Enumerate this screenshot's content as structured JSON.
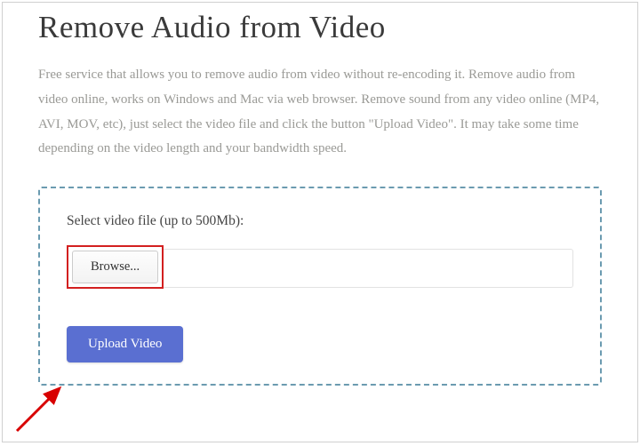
{
  "title": "Remove Audio from Video",
  "description": "Free service that allows you to remove audio from video without re-encoding it. Remove audio from video online, works on Windows and Mac via web browser. Remove sound from any video online (MP4, AVI, MOV, etc), just select the video file and click the button \"Upload Video\". It may take some time depending on the video length and your bandwidth speed.",
  "form": {
    "select_label": "Select video file (up to 500Mb):",
    "browse_label": "Browse...",
    "file_value": "",
    "upload_label": "Upload Video"
  },
  "colors": {
    "dashed_border": "#6b9bb0",
    "upload_button": "#5a6fd1",
    "highlight_box": "#d32020",
    "arrow": "#d80000"
  }
}
